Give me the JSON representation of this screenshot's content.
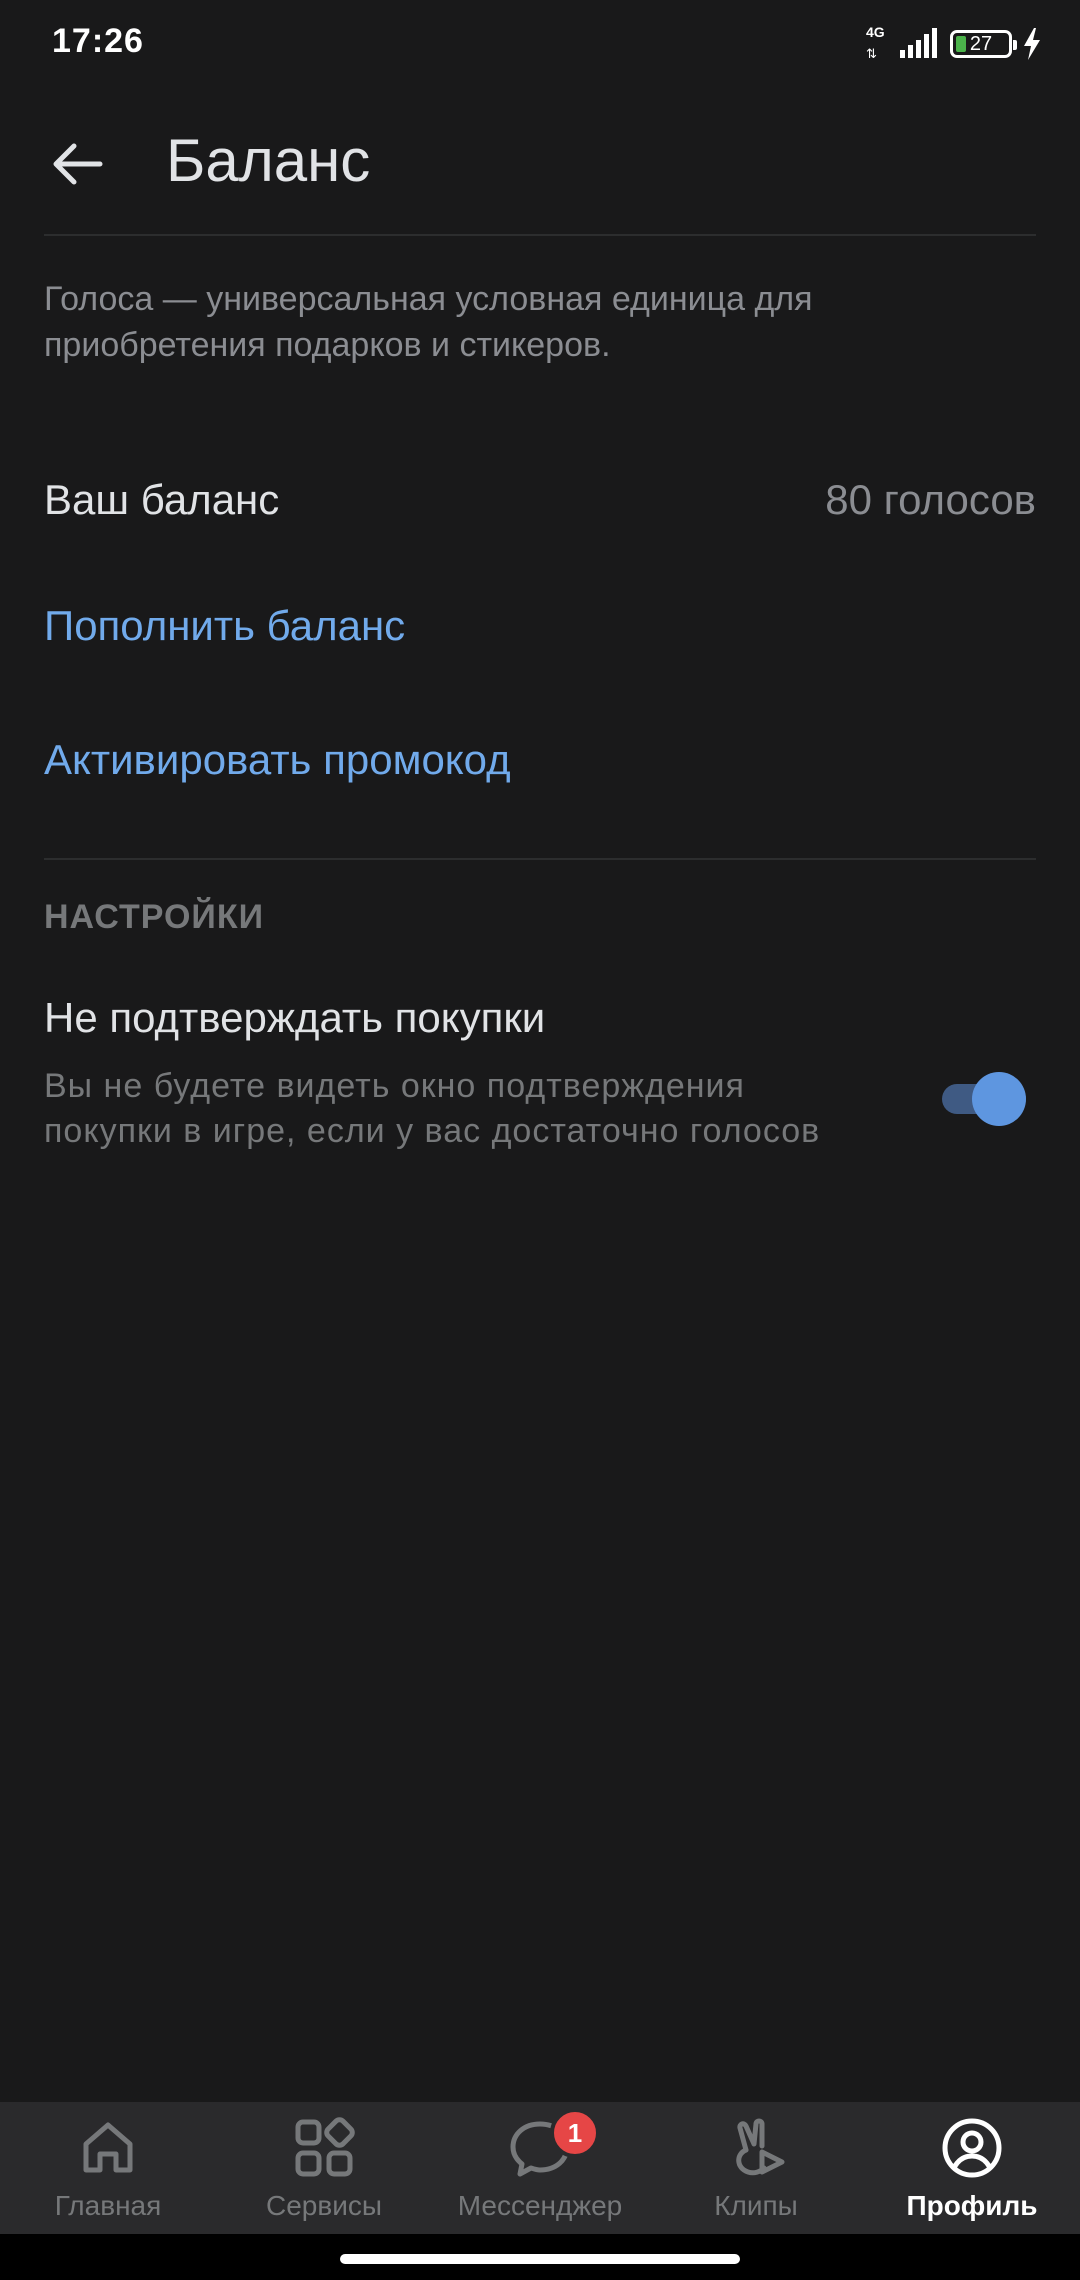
{
  "status_bar": {
    "time": "17:26",
    "network_type": "4G",
    "network_arrows": "⇅",
    "battery_level": "27",
    "icons": [
      "signal-icon",
      "battery-icon",
      "charging-icon"
    ]
  },
  "header": {
    "title": "Баланс",
    "back_icon": "arrow-left-icon"
  },
  "description": "Голоса — универсальная условная единица для приобретения подарков и стикеров.",
  "balance": {
    "label": "Ваш баланс",
    "value": "80 голосов"
  },
  "actions": {
    "topup": "Пополнить баланс",
    "promo": "Активировать промокод"
  },
  "settings": {
    "section_title": "НАСТРОЙКИ",
    "no_confirm": {
      "title": "Не подтверждать покупки",
      "description": "Вы не будете видеть окно подтверждения покупки в игре, если у вас достаточно голосов",
      "enabled": true
    }
  },
  "tab_bar": {
    "items": [
      {
        "label": "Главная",
        "icon": "home-icon",
        "active": false
      },
      {
        "label": "Сервисы",
        "icon": "services-icon",
        "active": false
      },
      {
        "label": "Мессенджер",
        "icon": "messenger-icon",
        "active": false,
        "badge": "1"
      },
      {
        "label": "Клипы",
        "icon": "clips-icon",
        "active": false
      },
      {
        "label": "Профиль",
        "icon": "profile-icon",
        "active": true
      }
    ]
  },
  "colors": {
    "background": "#19191a",
    "accent": "#71aaeb",
    "toggle_on": "#5e96e0",
    "badge": "#e64646",
    "tab_bar": "#2a2a2c"
  }
}
